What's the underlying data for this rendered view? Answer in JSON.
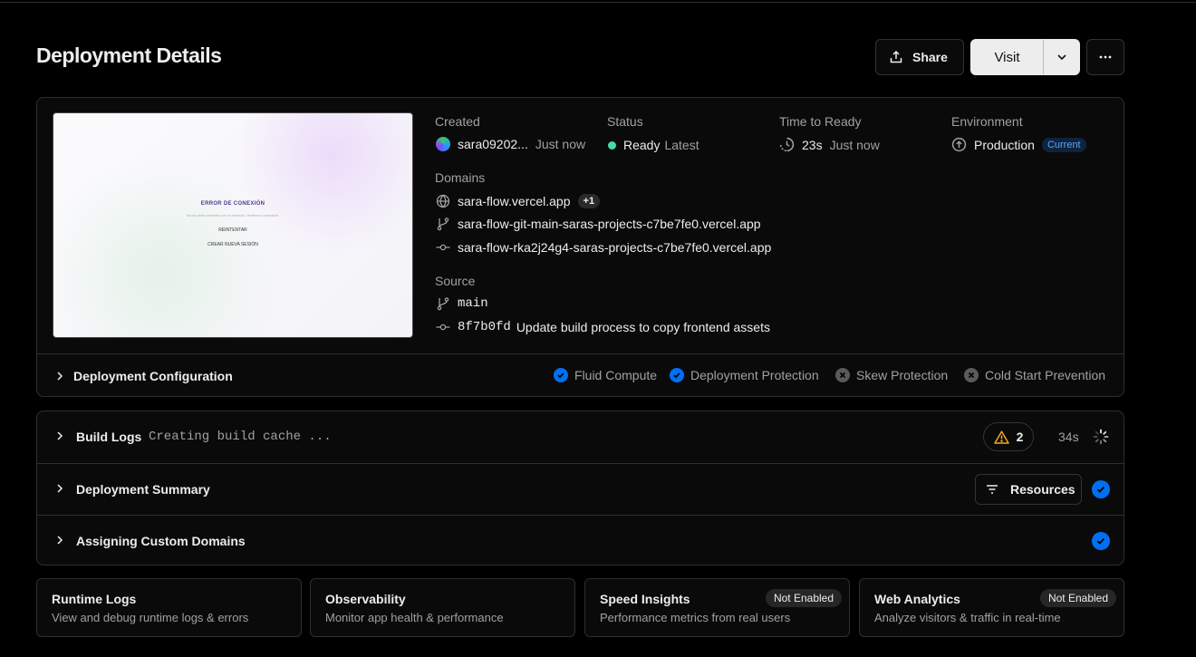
{
  "page": {
    "title": "Deployment Details"
  },
  "header": {
    "share_label": "Share",
    "visit_label": "Visit"
  },
  "preview": {
    "error_title": "ERROR DE CONEXIÓN",
    "error_message": "No se pudo conectar con el servidor. Verifica tu conexión.",
    "retry_label": "REINTENTAR",
    "new_session_label": "CREAR NUEVA SESIÓN"
  },
  "info": {
    "created_label": "Created",
    "created_user": "sara09202...",
    "created_time": "Just now",
    "status_label": "Status",
    "status_value": "Ready",
    "status_tag": "Latest",
    "ttr_label": "Time to Ready",
    "ttr_value": "23s",
    "ttr_time": "Just now",
    "env_label": "Environment",
    "env_value": "Production",
    "env_badge": "Current",
    "domains_label": "Domains",
    "domains": [
      "sara-flow.vercel.app",
      "sara-flow-git-main-saras-projects-c7be7fe0.vercel.app",
      "sara-flow-rka2j24g4-saras-projects-c7be7fe0.vercel.app"
    ],
    "domains_more": "+1",
    "source_label": "Source",
    "branch": "main",
    "commit_hash": "8f7b0fd",
    "commit_message": "Update build process to copy frontend assets"
  },
  "config": {
    "title": "Deployment Configuration",
    "features": [
      {
        "label": "Fluid Compute",
        "enabled": true
      },
      {
        "label": "Deployment Protection",
        "enabled": true
      },
      {
        "label": "Skew Protection",
        "enabled": false
      },
      {
        "label": "Cold Start Prevention",
        "enabled": false
      }
    ]
  },
  "steps": {
    "build_logs": {
      "title": "Build Logs",
      "status": "Creating build cache ...",
      "warnings": "2",
      "duration": "34s"
    },
    "summary": {
      "title": "Deployment Summary",
      "resources_label": "Resources"
    },
    "domains": {
      "title": "Assigning Custom Domains"
    }
  },
  "cards": [
    {
      "title": "Runtime Logs",
      "desc": "View and debug runtime logs & errors",
      "badge": ""
    },
    {
      "title": "Observability",
      "desc": "Monitor app health & performance",
      "badge": ""
    },
    {
      "title": "Speed Insights",
      "desc": "Performance metrics from real users",
      "badge": "Not Enabled"
    },
    {
      "title": "Web Analytics",
      "desc": "Analyze visitors & traffic in real-time",
      "badge": "Not Enabled"
    }
  ],
  "colors": {
    "accent": "#0070f3",
    "ready": "#45dca8",
    "warning": "#f5a623"
  }
}
